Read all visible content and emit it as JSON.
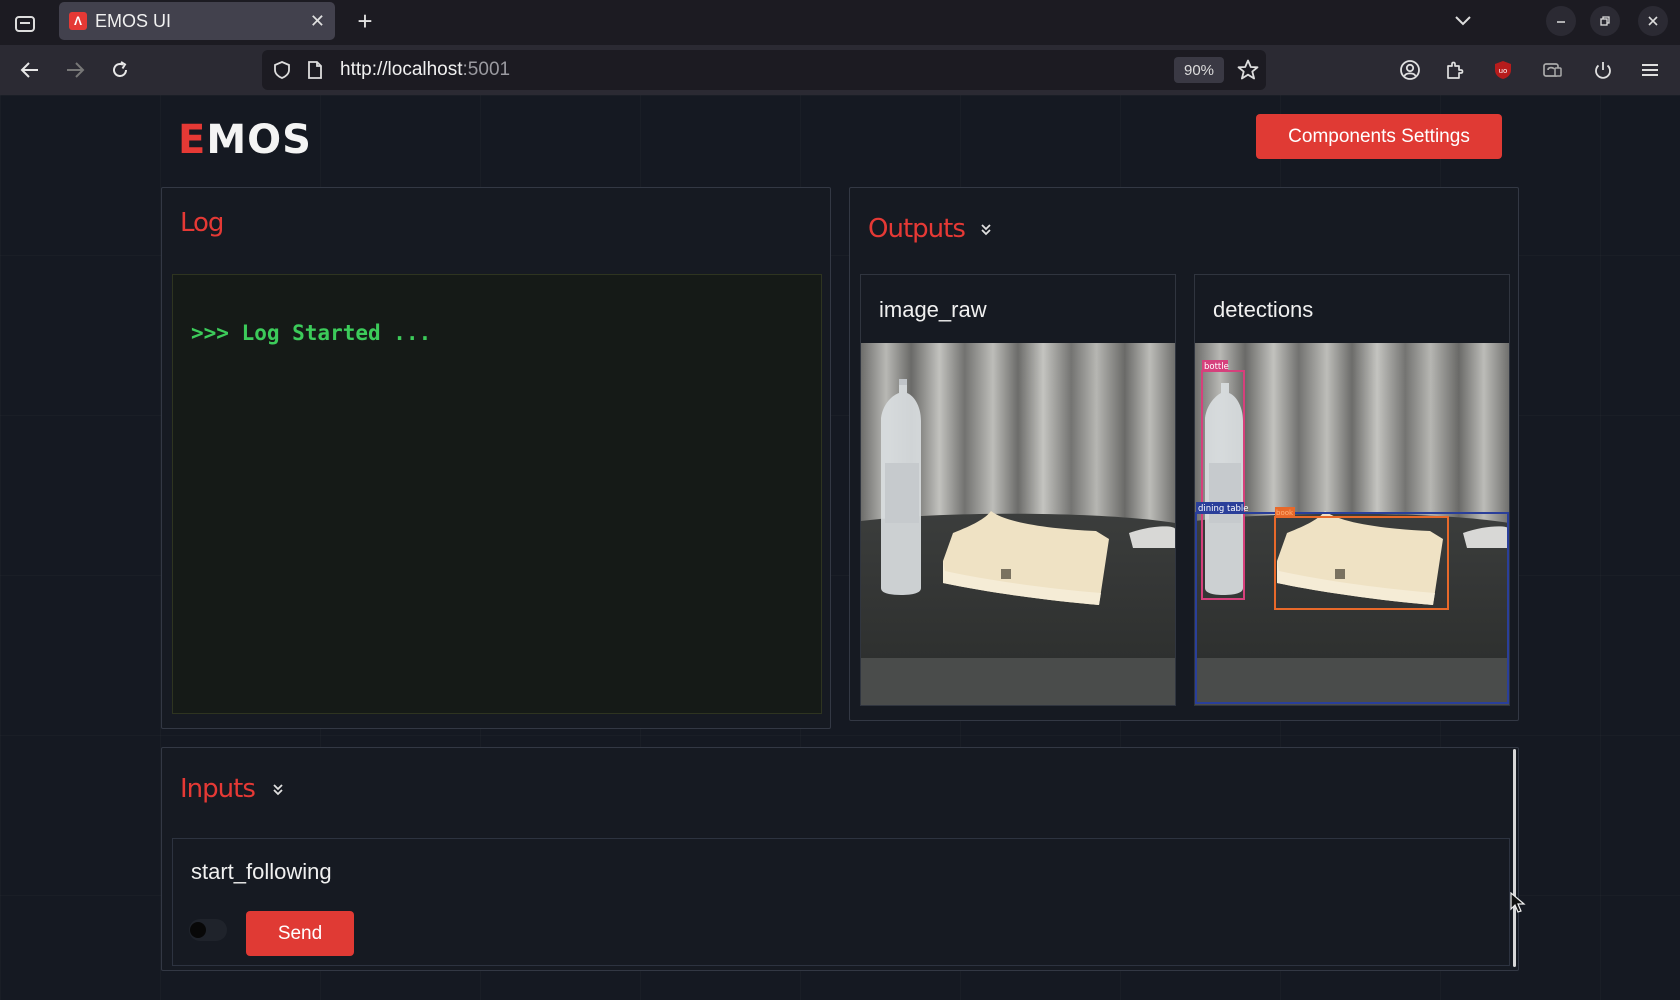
{
  "browser": {
    "tab_title": "EMOS UI",
    "url_host": "http://localhost",
    "url_port": ":5001",
    "zoom": "90%",
    "new_tab_label": "+",
    "close_tab_label": "✕"
  },
  "header": {
    "logo_first": "E",
    "logo_rest": "MOS",
    "settings_button": "Components Settings"
  },
  "log": {
    "title": "Log",
    "lines": [
      ">>> Log Started ..."
    ]
  },
  "outputs": {
    "title": "Outputs",
    "cards": [
      {
        "title": "image_raw"
      },
      {
        "title": "detections",
        "labels": [
          "bottle",
          "dining table",
          "book"
        ]
      }
    ]
  },
  "inputs": {
    "title": "Inputs",
    "cards": [
      {
        "title": "start_following",
        "toggle_on": false,
        "send_label": "Send"
      }
    ]
  },
  "colors": {
    "accent": "#e53935",
    "log_text": "#3ccb5a",
    "background": "#151922"
  }
}
